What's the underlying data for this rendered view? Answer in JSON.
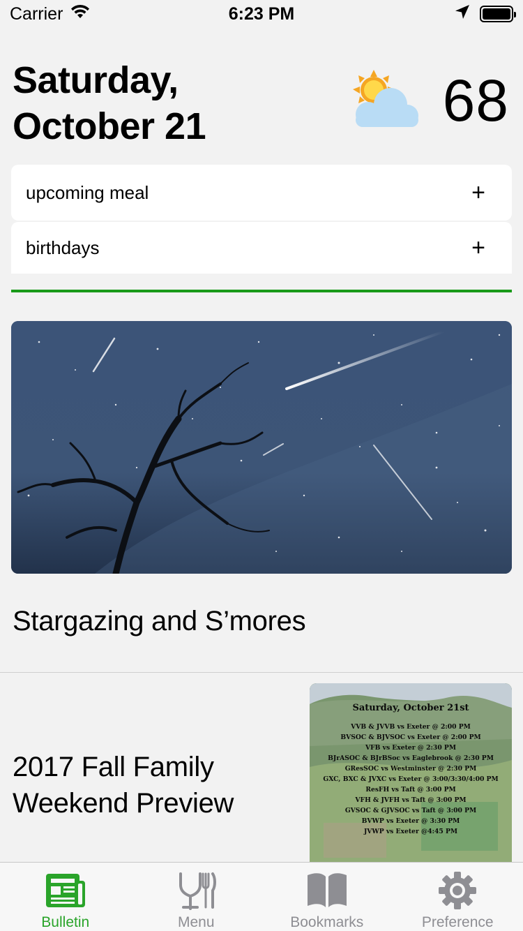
{
  "status_bar": {
    "carrier": "Carrier",
    "time": "6:23 PM",
    "icons": [
      "wifi-icon",
      "location-arrow-icon",
      "battery-icon"
    ]
  },
  "header": {
    "date_line1": "Saturday,",
    "date_line2": "October 21",
    "weather_icon": "partly-cloudy-icon",
    "temperature": "68"
  },
  "cards": [
    {
      "label": "upcoming meal",
      "action": "+"
    },
    {
      "label": "birthdays",
      "action": "+"
    }
  ],
  "colors": {
    "accent_green": "#1a9a1a",
    "tab_active": "#2aa42a",
    "tab_inactive": "#8e8e93",
    "background": "#f2f2f2"
  },
  "articles": [
    {
      "title": "Stargazing and S’mores",
      "image": "night-sky-meteor-photo"
    },
    {
      "title": "2017 Fall Family Weekend Preview",
      "image": "schedule-poster-photo"
    }
  ],
  "poster": {
    "heading": "Saturday, October 21st",
    "lines": [
      "VVB & JVVB  vs Exeter @ 2:00 PM",
      "BVSOC & BJVSOC vs Exeter @ 2:00 PM",
      "VFB vs Exeter @ 2:30 PM",
      "BJrASOC & BJrBSoc vs Eaglebrook @ 2:30 PM",
      "GResSOC vs  Westminster @ 2:30 PM",
      "GXC, BXC & JVXC vs Exeter @ 3:00/3:30/4:00 PM",
      "ResFH vs Taft @ 3:00 PM",
      "VFH & JVFH vs Taft @ 3:00 PM",
      "GVSOC & GJVSOC vs Taft @ 3:00 PM",
      "BVWP vs Exeter @ 3:30 PM",
      "JVWP vs Exeter @4:45 PM"
    ]
  },
  "tabs": [
    {
      "label": "Bulletin",
      "icon": "newspaper-icon",
      "active": true
    },
    {
      "label": "Menu",
      "icon": "fork-knife-icon",
      "active": false
    },
    {
      "label": "Bookmarks",
      "icon": "book-icon",
      "active": false
    },
    {
      "label": "Preference",
      "icon": "gear-icon",
      "active": false
    }
  ]
}
